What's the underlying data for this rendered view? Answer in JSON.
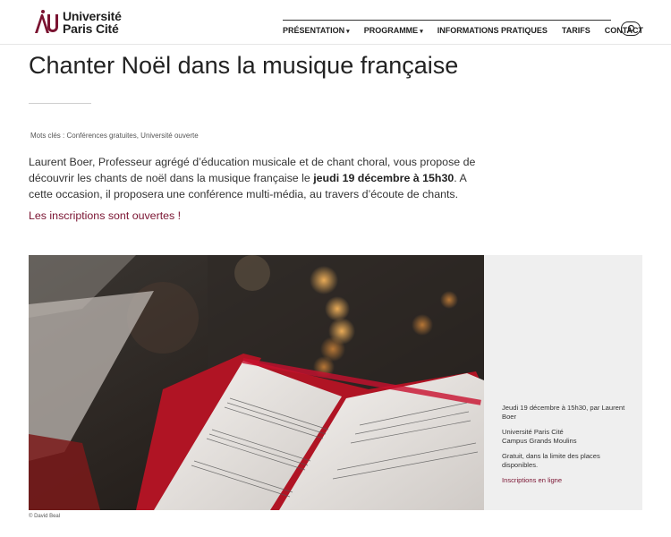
{
  "brand": {
    "line1": "Université",
    "line2": "Paris Cité"
  },
  "nav": {
    "items": [
      {
        "label": "PRÉSENTATION",
        "dropdown": true
      },
      {
        "label": "PROGRAMME",
        "dropdown": true
      },
      {
        "label": "INFORMATIONS PRATIQUES",
        "dropdown": false
      },
      {
        "label": "TARIFS",
        "dropdown": false
      },
      {
        "label": "CONTACT",
        "dropdown": false
      }
    ],
    "search_icon": "search-icon"
  },
  "page": {
    "title": "Chanter Noël dans la musique française",
    "keywords_label": "Mots clés :",
    "keywords": "Conférences gratuites, Université ouverte",
    "description_part1": "Laurent Boer, Professeur agrégé d’éducation musicale et de chant choral, vous propose de découvrir les chants de noël dans la musique française  le ",
    "description_bold": "jeudi 19 décembre à 15h30",
    "description_part2": ". A cette occasion, il proposera une conférence multi-média, au travers d’écoute de chants.",
    "signup_text": "Les inscriptions sont ouvertes !"
  },
  "event_info": {
    "date_line": "Jeudi 19 décembre à 15h30, par Laurent Boer",
    "location_line1": "Université Paris Cité",
    "location_line2": "Campus Grands Moulins",
    "price_line": "Gratuit, dans la limite des places disponibles.",
    "register_link": "Inscriptions en ligne"
  },
  "photo_credit": "© David Beal",
  "colors": {
    "accent": "#7a1331",
    "panel": "#efefef"
  }
}
